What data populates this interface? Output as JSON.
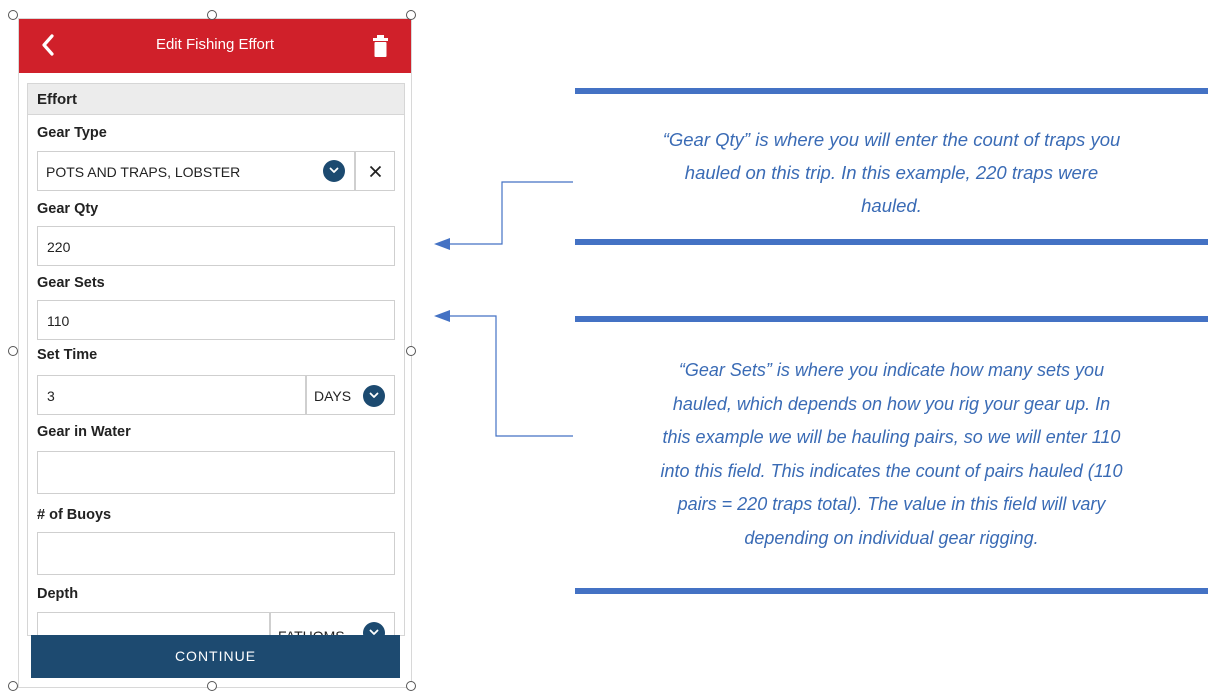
{
  "app_bar": {
    "title": "Edit Fishing Effort",
    "back_icon": "chevron-left-icon",
    "delete_icon": "trash-icon",
    "color": "#d0202a"
  },
  "form": {
    "section_title": "Effort",
    "gear_type": {
      "label": "Gear Type",
      "value": "POTS AND TRAPS, LOBSTER",
      "clear_symbol": "✕"
    },
    "gear_qty": {
      "label": "Gear Qty",
      "value": "220"
    },
    "gear_sets": {
      "label": "Gear Sets",
      "value": "110"
    },
    "set_time": {
      "label": "Set Time",
      "value": "3",
      "unit": "DAYS"
    },
    "gear_in_water": {
      "label": "Gear in Water",
      "value": ""
    },
    "buoys": {
      "label": "# of Buoys",
      "value": ""
    },
    "depth": {
      "label": "Depth",
      "value": "",
      "unit": "FATHOMS"
    }
  },
  "continue_label": "CONTINUE",
  "accent_color": "#1d4a70",
  "callouts": {
    "gear_qty": [
      "“Gear Qty” is where you will enter the count of traps you",
      "hauled on this trip.  In this example, 220 traps were",
      "hauled."
    ],
    "gear_sets": [
      "“Gear Sets” is where you indicate how many sets you",
      "hauled, which depends on how you rig your gear up. In",
      "this example we will be hauling pairs, so we will enter 110",
      "into this field. This indicates the count of pairs hauled (110",
      "pairs = 220 traps total). The value in this field will vary",
      "depending on individual gear rigging."
    ],
    "bar_color": "#4472c4",
    "text_color": "#3a6bb5"
  }
}
